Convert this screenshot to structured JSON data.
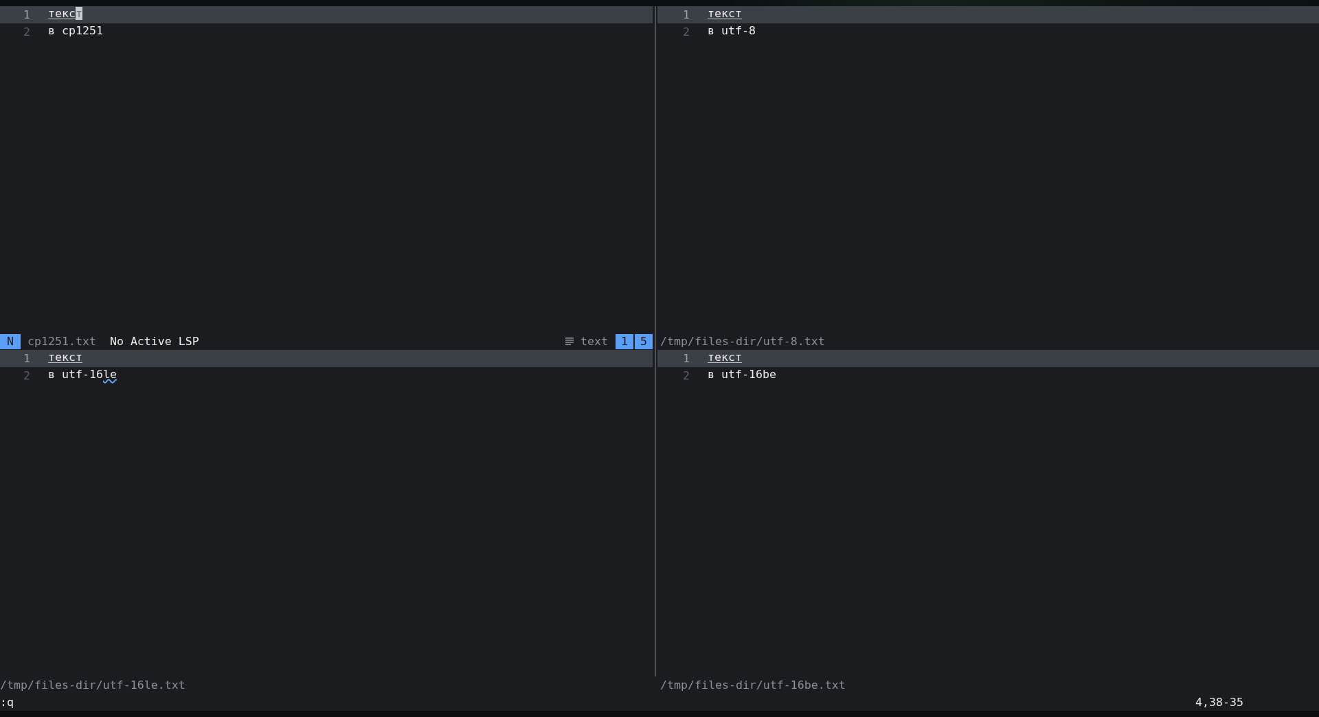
{
  "panes": [
    {
      "lines": [
        {
          "number": "1",
          "current": true,
          "cursor": true,
          "segments": [
            {
              "text": "текст",
              "underlined": true,
              "flagged": false
            }
          ]
        },
        {
          "number": "2",
          "current": false,
          "cursor": false,
          "segments": [
            {
              "text": "в cp1251",
              "underlined": false,
              "flagged": false
            }
          ]
        }
      ],
      "status": {
        "kind": "full",
        "mode": "N",
        "file": "cp1251.txt",
        "lsp": "No Active LSP",
        "filetype": "text",
        "badges": [
          "1",
          "5"
        ]
      }
    },
    {
      "lines": [
        {
          "number": "1",
          "current": true,
          "cursor": false,
          "segments": [
            {
              "text": "текст",
              "underlined": true,
              "flagged": false
            }
          ]
        },
        {
          "number": "2",
          "current": false,
          "cursor": false,
          "segments": [
            {
              "text": "в utf-8",
              "underlined": false,
              "flagged": false
            }
          ]
        }
      ],
      "status": {
        "kind": "path",
        "path": "/tmp/files-dir/utf-8.txt"
      }
    },
    {
      "lines": [
        {
          "number": "1",
          "current": true,
          "cursor": false,
          "segments": [
            {
              "text": "текст",
              "underlined": true,
              "flagged": false
            }
          ]
        },
        {
          "number": "2",
          "current": false,
          "cursor": false,
          "segments": [
            {
              "text": "в utf-16",
              "underlined": false,
              "flagged": false
            },
            {
              "text": "le",
              "underlined": false,
              "flagged": true
            }
          ]
        }
      ],
      "status": {
        "kind": "path",
        "path": "/tmp/files-dir/utf-16le.txt"
      }
    },
    {
      "lines": [
        {
          "number": "1",
          "current": true,
          "cursor": false,
          "segments": [
            {
              "text": "текст",
              "underlined": true,
              "flagged": false
            }
          ]
        },
        {
          "number": "2",
          "current": false,
          "cursor": false,
          "segments": [
            {
              "text": "в utf-16be",
              "underlined": false,
              "flagged": false
            }
          ]
        }
      ],
      "status": {
        "kind": "path",
        "path": "/tmp/files-dir/utf-16be.txt"
      }
    }
  ],
  "command_line": {
    "text": ":q",
    "ruler": "4,38-35"
  }
}
